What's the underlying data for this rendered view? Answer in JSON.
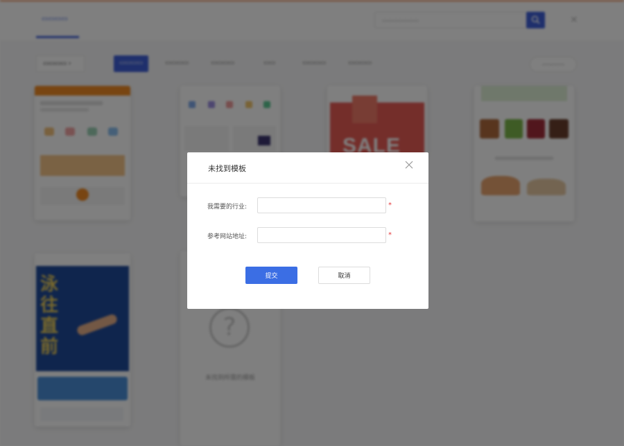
{
  "modal": {
    "title": "未找到模板",
    "fields": [
      {
        "label": "我需要的行业:",
        "value": "",
        "placeholder": "",
        "required_mark": "*"
      },
      {
        "label": "参考网站地址:",
        "value": "",
        "placeholder": "",
        "required_mark": "*"
      }
    ],
    "submit_label": "提交",
    "cancel_label": "取消"
  },
  "background": {
    "sale_text": "SALE",
    "pool_title": "泳往直前",
    "no_template_text": "未找到所需的模板"
  },
  "colors": {
    "accent": "#3b6ee4",
    "required": "#e4393c",
    "overlay": "rgba(0,0,0,0.5)"
  },
  "icons": [
    "close-icon",
    "search-icon",
    "question-icon"
  ]
}
